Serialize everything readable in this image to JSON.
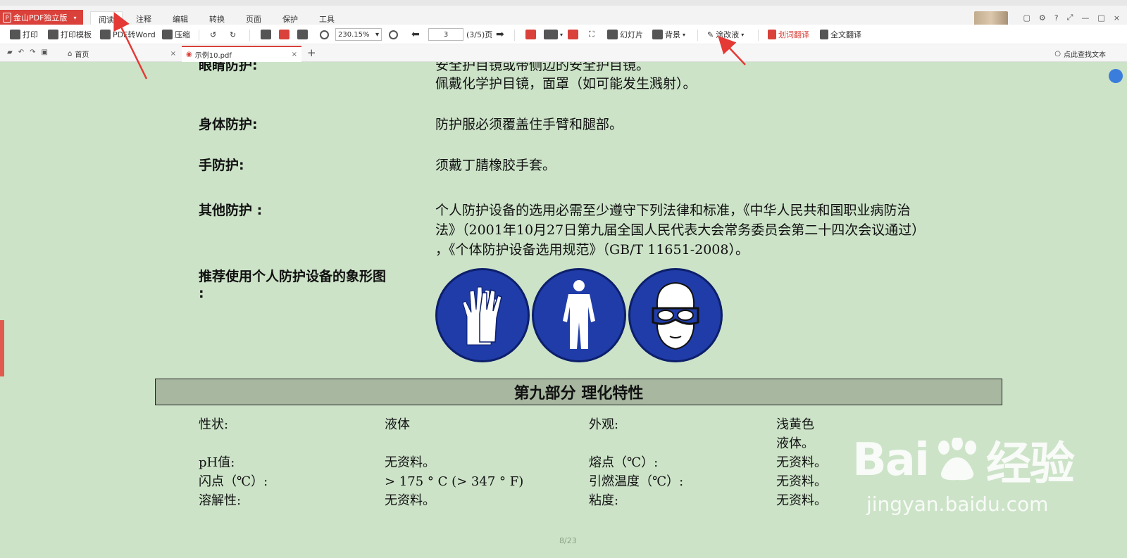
{
  "app": {
    "brand_label": "金山PDF独立版",
    "menu_tabs": [
      "阅读",
      "注释",
      "编辑",
      "转换",
      "页面",
      "保护",
      "工具"
    ],
    "active_tab": "阅读",
    "window_controls": [
      "?",
      "—",
      "□",
      "×"
    ]
  },
  "toolbar": {
    "print": "打印",
    "print_template": "打印模板",
    "pdf_to_word": "PDF转Word",
    "compress": "压缩",
    "zoom_value": "230.15%",
    "page_input": "3",
    "page_total": "(3/5)页",
    "slideshow": "幻灯片",
    "background": "背景",
    "correction_fluid": "涂改液",
    "word_translate": "划词翻译",
    "full_translate": "全文翻译"
  },
  "tabs": {
    "home": "首页",
    "document": "示例10.pdf",
    "search_text": "点此查找文本"
  },
  "document": {
    "eye_label": "眼睛防护:",
    "eye_line1": "安全护目镜或带侧边的安全护目镜。",
    "eye_line2": "佩戴化学护目镜，面罩（如可能发生溅射）。",
    "body_label": "身体防护:",
    "body_text": "防护服必须覆盖住手臂和腿部。",
    "hand_label": "手防护:",
    "hand_text": "须戴丁腈橡胶手套。",
    "other_label": "其他防护 :",
    "other_line1": "个人防护设备的选用必需至少遵守下列法律和标准，《中华人民共和国职业病防治",
    "other_line2": "法》（2001年10月27日第九届全国人民代表大会常务委员会第二十四次会议通过）",
    "other_line3": "，《个体防护设备选用规范》（GB/T 11651-2008）。",
    "picto_label_line1": "推荐使用个人防护设备的象形图",
    "picto_label_line2": ":",
    "section_title": "第九部分 理化特性",
    "props": [
      {
        "k1": "性状:",
        "v1": "液体",
        "k2": "外观:",
        "v2": "浅黄色"
      },
      {
        "k1": "",
        "v1": "",
        "k2": "",
        "v2": "液体。"
      },
      {
        "k1": "pH值:",
        "v1": "无资料。",
        "k2": "熔点（℃）:",
        "v2": "无资料。"
      },
      {
        "k1": "闪点（℃）:",
        "v1": "> 175 ° C (> 347 ° F)",
        "k2": "引燃温度（℃）:",
        "v2": "无资料。"
      },
      {
        "k1": "溶解性:",
        "v1": "无资料。",
        "k2": "粘度:",
        "v2": "无资料。"
      }
    ],
    "page_number": "8/23"
  },
  "watermark": {
    "big": "Bai",
    "big2": "经验",
    "small": "jingyan.baidu.com"
  },
  "colors": {
    "brand_red": "#d9413a",
    "doc_background": "#cce3c8",
    "picto_blue": "#1f3ca8",
    "section_bar": "#a7b7a0",
    "annotation_arrow": "#e53935"
  },
  "icons": [
    "print-icon",
    "template-icon",
    "word-icon",
    "compress-icon",
    "rotate-left-icon",
    "rotate-right-icon",
    "zoom-out-icon",
    "zoom-in-icon",
    "prev-page-icon",
    "next-page-icon",
    "slideshow-icon",
    "background-icon",
    "eraser-icon",
    "translate-icon",
    "home-icon",
    "pdf-icon",
    "search-icon",
    "gloves-pictogram",
    "coverall-pictogram",
    "goggles-pictogram"
  ]
}
